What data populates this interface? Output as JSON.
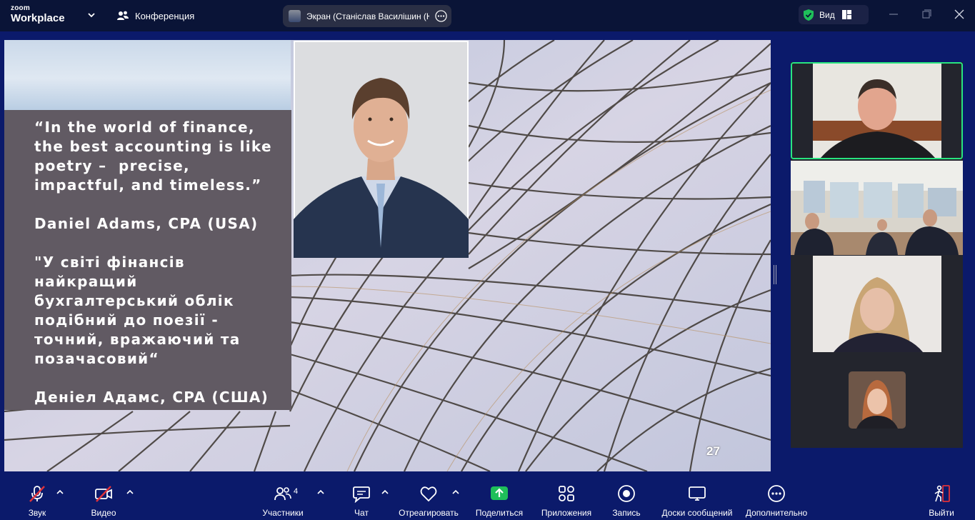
{
  "app": {
    "logo_small": "zoom",
    "logo_big": "Workplace"
  },
  "topbar": {
    "conference_label": "Конференция",
    "screen_share_label": "Экран (Станіслав Василішин (ЮФ",
    "view_label": "Вид"
  },
  "slide": {
    "quote_lines": [
      "“In the world of finance,",
      "the best accounting is like",
      "poetry –  precise,",
      "impactful, and timeless.”",
      "",
      "Daniel Adams, CPA (USA)",
      "",
      "\"У світі фінансів",
      "найкращий",
      "бухгалтерський облік",
      "подібний до поезії -",
      "точний, вражаючий та",
      "позачасовий“",
      "",
      "Деніел Адамс, CPA (США)"
    ],
    "page_number": "27"
  },
  "toolbar": {
    "audio_label": "Звук",
    "video_label": "Видео",
    "participants_label": "Участники",
    "participants_count": "4",
    "chat_label": "Чат",
    "react_label": "Отреагировать",
    "share_label": "Поделиться",
    "apps_label": "Приложения",
    "record_label": "Запись",
    "whiteboards_label": "Доски сообщений",
    "more_label": "Дополнительно",
    "leave_label": "Выйти"
  },
  "colors": {
    "app_background": "#0b1a6b",
    "topbar_background": "#0a1437",
    "quote_box": "#615a63",
    "active_speaker_border": "#29e57f",
    "share_button_green": "#1fbf5a",
    "muted_red": "#e0323a"
  },
  "icons": {
    "conference": "people-icon",
    "security": "shield-check-icon",
    "audio": "microphone-muted-icon",
    "video": "camera-off-icon",
    "participants": "participants-icon",
    "chat": "chat-icon",
    "react": "heart-icon",
    "share": "share-screen-icon",
    "apps": "apps-icon",
    "record": "record-icon",
    "whiteboards": "whiteboard-icon",
    "more": "more-icon",
    "leave": "leave-icon"
  }
}
